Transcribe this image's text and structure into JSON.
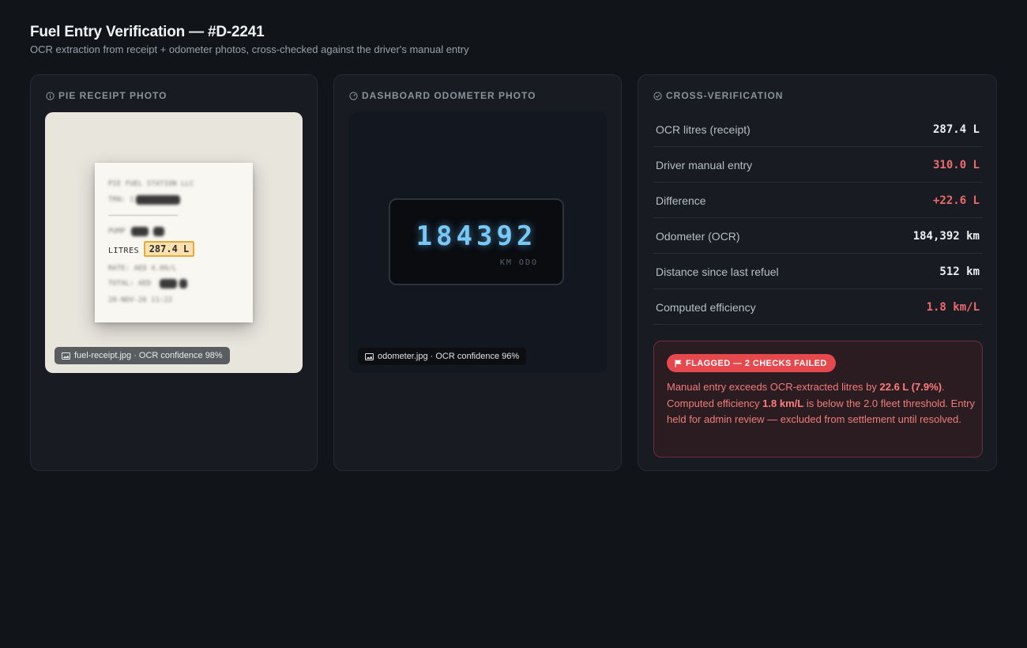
{
  "header": {
    "title": "Fuel Entry Verification — #D-2241",
    "subtitle": "OCR extraction from receipt + odometer photos, cross-checked against the driver's manual entry"
  },
  "receipt_card": {
    "icon": "info-icon",
    "heading": "PIE RECEIPT PHOTO",
    "receipt_lines": {
      "station": "PIE FUEL STATION LLC",
      "trn": "TRN: 1",
      "pump": "PUMP",
      "litres_label": "LITRES",
      "litres_value": "287.4 L",
      "rate": "RATE:   AED 4.00/L",
      "total": "TOTAL:  AED",
      "date": "28-NOV-26 11:22"
    },
    "caption": "fuel-receipt.jpg · OCR confidence 98%"
  },
  "odometer_card": {
    "icon": "gauge-icon",
    "heading": "DASHBOARD ODOMETER PHOTO",
    "reading": "184392",
    "unit": "KM  ODO",
    "caption": "odometer.jpg · OCR confidence 96%"
  },
  "verification_card": {
    "icon": "check-circle-icon",
    "heading": "CROSS-VERIFICATION",
    "rows": [
      {
        "label": "OCR litres (receipt)",
        "value": "287.4 L"
      },
      {
        "label": "Driver manual entry",
        "value": "310.0 L"
      },
      {
        "label": "Difference",
        "value": "+22.6 L"
      },
      {
        "label": "Odometer (OCR)",
        "value": "184,392 km"
      },
      {
        "label": "Distance since last refuel",
        "value": "512 km"
      },
      {
        "label": "Computed efficiency",
        "value": "1.8 km/L"
      }
    ],
    "flag": {
      "badge": "FLAGGED — 2 CHECKS FAILED",
      "text_1": "Manual entry exceeds OCR-extracted litres by ",
      "text_1b": "22.6 L (7.9%)",
      "text_2": ". Computed efficiency ",
      "text_2b": "1.8 km/L",
      "text_3": " is below the 2.0 fleet threshold. Entry held for admin review — excluded from settlement until resolved."
    }
  },
  "colors": {
    "background": "#111418",
    "card": "#181c22",
    "danger": "#f06a6a",
    "badge": "#e5484d",
    "highlight": "#e6a93c",
    "odometer_glow": "#79c8f5"
  }
}
